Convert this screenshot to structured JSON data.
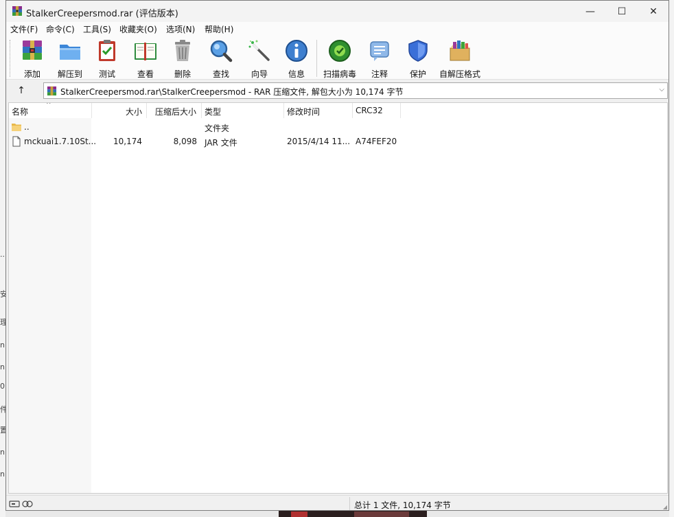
{
  "window": {
    "title": "StalkerCreepersmod.rar (评估版本)",
    "min_glyph": "—",
    "max_glyph": "☐",
    "close_glyph": "✕"
  },
  "menu": [
    "文件(F)",
    "命令(C)",
    "工具(S)",
    "收藏夹(O)",
    "选项(N)",
    "帮助(H)"
  ],
  "toolbar": {
    "add": "添加",
    "extract_to": "解压到",
    "test": "测试",
    "view": "查看",
    "delete": "删除",
    "find": "查找",
    "wizard": "向导",
    "info": "信息",
    "virus_scan": "扫描病毒",
    "comment": "注释",
    "protect": "保护",
    "sfx": "自解压格式"
  },
  "address": {
    "up_glyph": "↑",
    "path": "StalkerCreepersmod.rar\\StalkerCreepersmod - RAR 压缩文件, 解包大小为 10,174 字节",
    "chevron": "⌵"
  },
  "columns": {
    "name": "名称",
    "size": "大小",
    "packed": "压缩后大小",
    "type": "类型",
    "modified": "修改时间",
    "crc": "CRC32",
    "sort_glyph": "^"
  },
  "rows": [
    {
      "name": "..",
      "size": "",
      "packed": "",
      "type": "文件夹",
      "modified": "",
      "crc": ""
    },
    {
      "name": "mckuai1.7.10St...",
      "size": "10,174",
      "packed": "8,098",
      "type": "JAR 文件",
      "modified": "2015/4/14 11...",
      "crc": "A74FEF20"
    }
  ],
  "status": {
    "text": "总计 1 文件, 10,174 字节"
  },
  "background_marks": [
    "..",
    "安",
    "理",
    "n",
    "n",
    "0",
    "件",
    "置",
    "n",
    "n"
  ]
}
